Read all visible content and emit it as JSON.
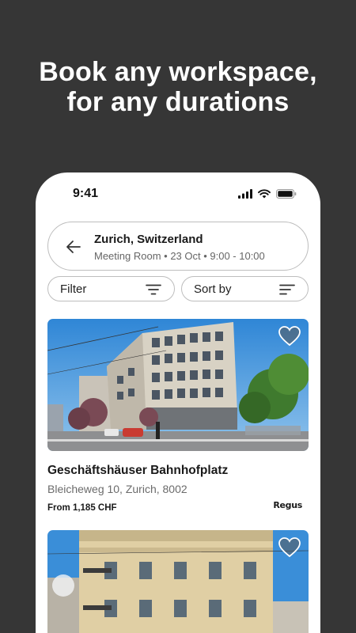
{
  "headline": {
    "line1": "Book any workspace,",
    "line2": "for any durations"
  },
  "status_bar": {
    "time": "9:41",
    "icons": [
      "signal-icon",
      "wifi-icon",
      "battery-icon"
    ]
  },
  "search": {
    "location": "Zurich, Switzerland",
    "details": "Meeting Room • 23 Oct • 9:00 - 10:00",
    "back_icon": "arrow-left-icon"
  },
  "filters": {
    "filter_label": "Filter",
    "sort_label": "Sort by"
  },
  "listings": [
    {
      "name": "Geschäftshäuser Bahnhofplatz",
      "address": "Bleicheweg 10, Zurich, 8002",
      "price": "From 1,185 CHF",
      "brand": "Regus"
    },
    {
      "name": "",
      "address": "",
      "price": "",
      "brand": ""
    }
  ],
  "colors": {
    "background": "#363636",
    "card": "#ffffff",
    "border": "#bdbdbd",
    "text_primary": "#1a1a1a",
    "text_secondary": "#6b6b6b"
  }
}
